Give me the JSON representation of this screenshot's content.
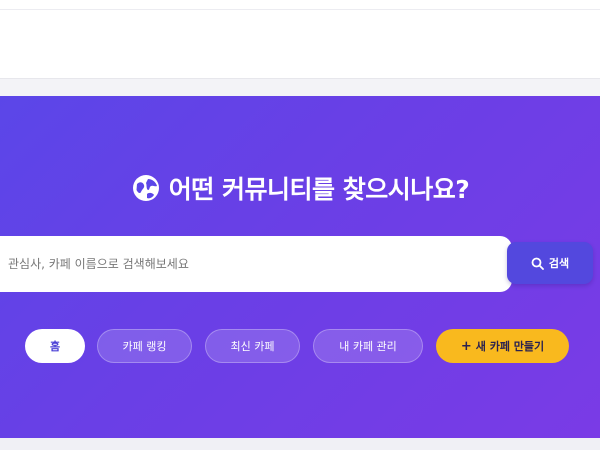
{
  "hero": {
    "title": "어떤 커뮤니티를 찾으시나요?",
    "icon": "globe-icon"
  },
  "search": {
    "placeholder": "관심사, 카페 이름으로 검색해보세요",
    "value": "",
    "button_label": "검색",
    "button_icon": "search-icon"
  },
  "nav": {
    "items": [
      {
        "label": "홈",
        "active": true
      },
      {
        "label": "카페 랭킹"
      },
      {
        "label": "최신 카페"
      },
      {
        "label": "내 카페 관리"
      }
    ],
    "create": {
      "label": "새 카페 만들기",
      "icon": "plus-icon"
    }
  },
  "colors": {
    "hero_gradient_start": "#5b46e8",
    "hero_gradient_end": "#7a3be6",
    "search_button": "#5348de",
    "create_button": "#f9b91e",
    "active_pill_bg": "#ffffff"
  }
}
